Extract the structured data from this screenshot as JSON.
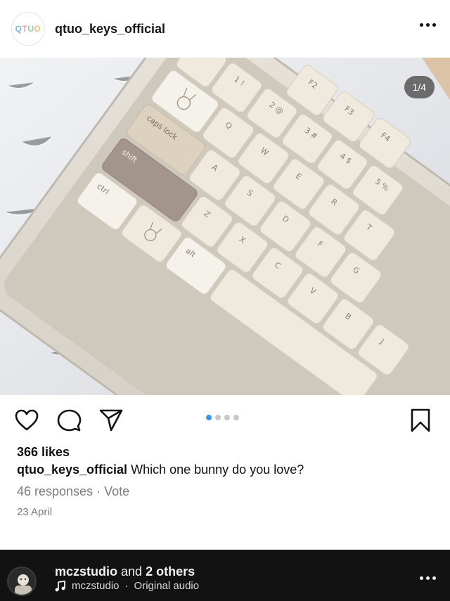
{
  "header": {
    "avatar_logo": [
      "Q",
      "T",
      "U",
      "O"
    ],
    "username": "qtuo_keys_official"
  },
  "photo": {
    "page_counter": "1/4",
    "keycaps": {
      "caps": "caps lock",
      "shift": "shift",
      "ctrl": "ctrl",
      "alt": "alt",
      "one": "1 !",
      "two": "2 @",
      "three": "3 #",
      "four": "4 $",
      "five": "5 %",
      "f2": "F2",
      "f3": "F3",
      "f4": "F4",
      "q": "Q",
      "w": "W",
      "e": "E",
      "r": "R",
      "t": "T",
      "a": "A",
      "s": "S",
      "d": "D",
      "f": "F",
      "g": "G",
      "z": "Z",
      "x": "X",
      "c": "C",
      "v": "V",
      "b": "B",
      "j": "J"
    }
  },
  "carousel": {
    "count": 4,
    "active": 1
  },
  "post": {
    "likes": "366 likes",
    "caption_user": "qtuo_keys_official",
    "caption_text": "Which one bunny do you love?",
    "responses": "46 responses",
    "separator": "·",
    "vote": "Vote",
    "date": "23 April"
  },
  "bottom": {
    "user": "mczstudio",
    "and": "and",
    "others": "2 others",
    "audio_user": "mczstudio",
    "audio_sep": "·",
    "audio_label": "Original audio"
  },
  "colors": {
    "accent": "#3897f0",
    "key_light": "#f1ece2",
    "key_tan": "#ddd1bf",
    "key_mocha": "#a3958c",
    "frame": "#dcd7cd"
  }
}
